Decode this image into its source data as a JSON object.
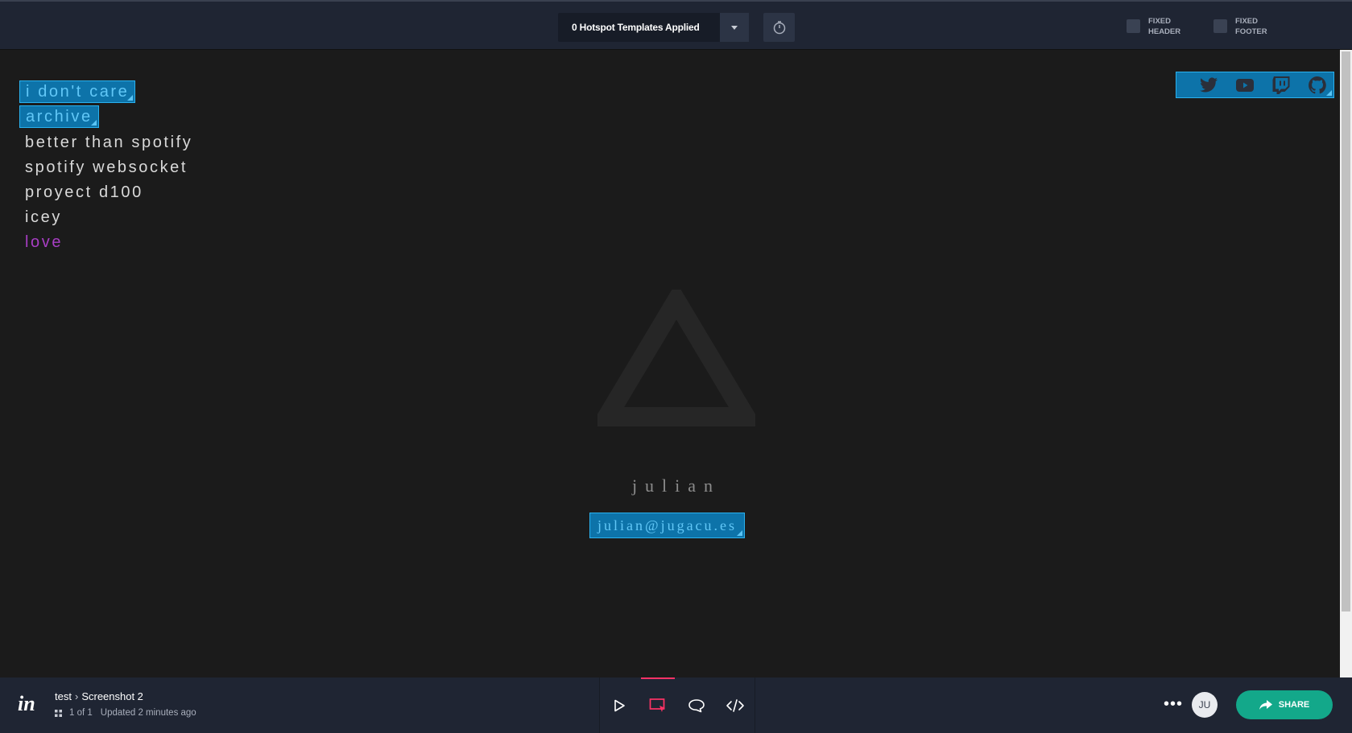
{
  "topbar": {
    "templates_label": "0 Hotspot Templates Applied",
    "fixed_header": {
      "line1": "FIXED",
      "line2": "HEADER"
    },
    "fixed_footer": {
      "line1": "FIXED",
      "line2": "FOOTER"
    }
  },
  "page": {
    "menu": [
      {
        "label": "i don't care",
        "hotspot": true
      },
      {
        "label": "archive",
        "hotspot": true
      },
      {
        "label": "better than spotify",
        "hotspot": false
      },
      {
        "label": "spotify websocket",
        "hotspot": false
      },
      {
        "label": "proyect d100",
        "hotspot": false
      },
      {
        "label": "icey",
        "hotspot": false
      },
      {
        "label": "love",
        "hotspot": false
      }
    ],
    "social_icons": [
      "twitter-icon",
      "youtube-icon",
      "twitch-icon",
      "github-icon"
    ],
    "name": "julian",
    "email": "julian@jugacu.es"
  },
  "bottombar": {
    "project": "test",
    "screen": "Screenshot 2",
    "position": "1 of 1",
    "updated": "Updated 2 minutes ago",
    "avatar_initials": "JU",
    "share_label": "SHARE",
    "more_label": "•••"
  },
  "colors": {
    "hotspot_fill": "#0d73a9",
    "hotspot_border": "#2ab1ee",
    "accent_pink": "#ff3366",
    "share_green": "#13a88a",
    "love_purple": "#a83ec4"
  }
}
